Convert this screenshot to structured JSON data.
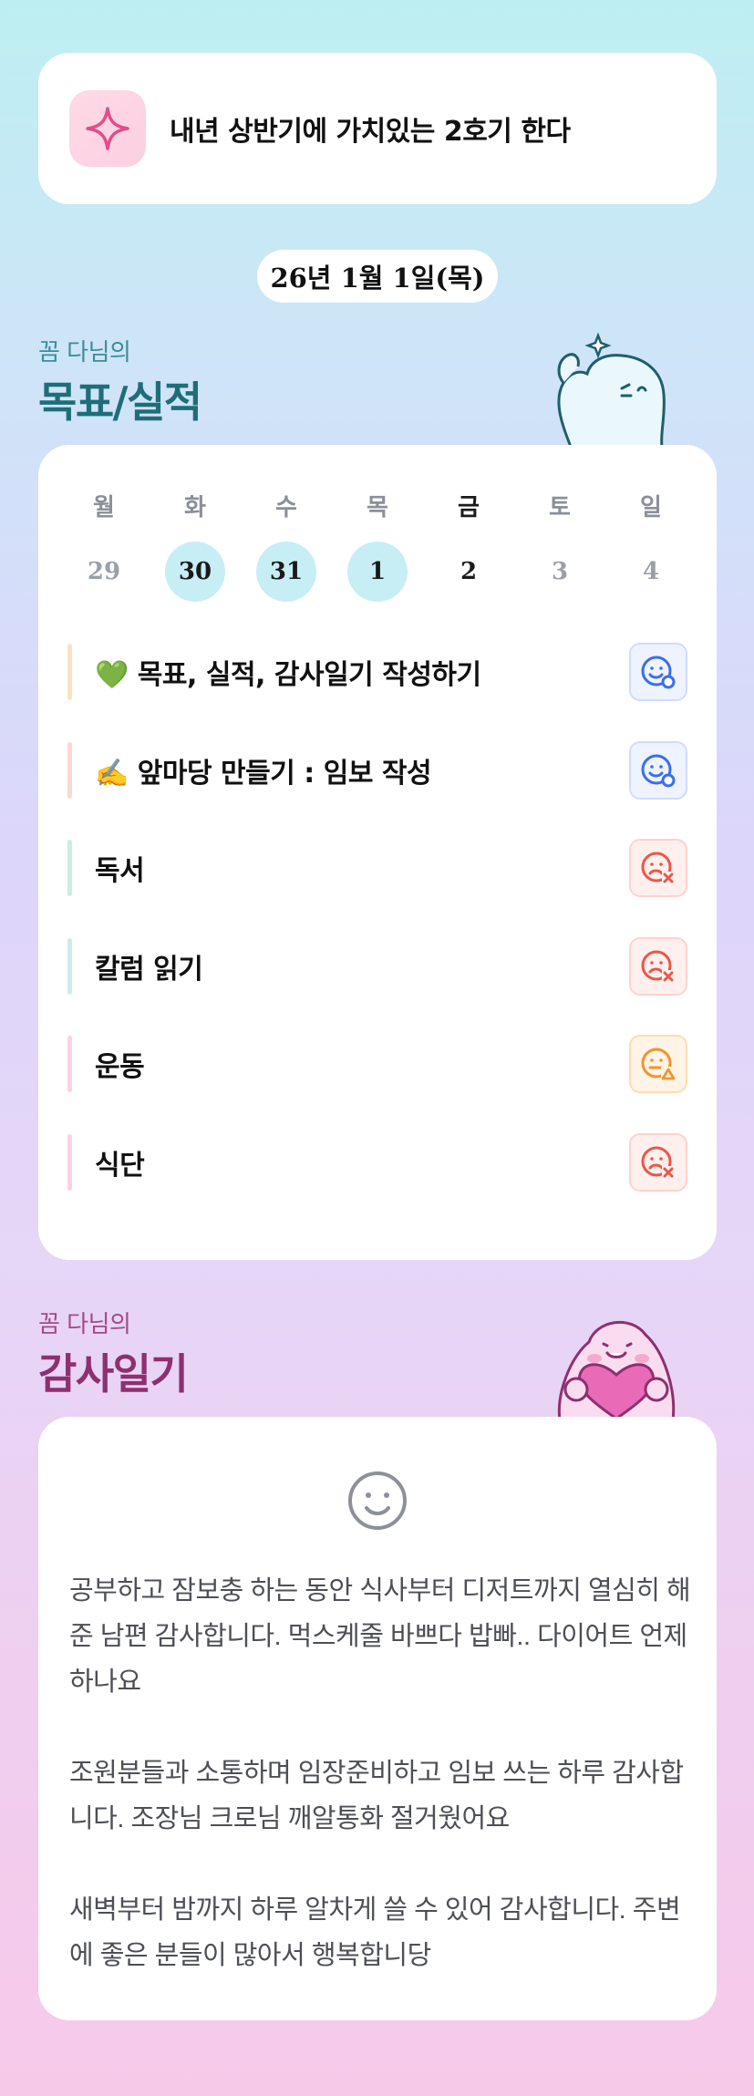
{
  "goal_banner": {
    "icon": "sparkle-icon",
    "text": "내년 상반기에 가치있는 2호기 한다"
  },
  "date": "26년 1월 1일(목)",
  "goals_section": {
    "owner": "꼼 다님의",
    "heading": "목표/실적"
  },
  "week": {
    "days_of_week": [
      "월",
      "화",
      "수",
      "목",
      "금",
      "토",
      "일"
    ],
    "dates": [
      "29",
      "30",
      "31",
      "1",
      "2",
      "3",
      "4"
    ],
    "marked": [
      false,
      true,
      true,
      true,
      false,
      false,
      false
    ],
    "today_index": 4
  },
  "tasks": [
    {
      "label": "💚 목표, 실적, 감사일기 작성하기",
      "status": "done",
      "bar_color": "#fbe3c2"
    },
    {
      "label": "✍️ 앞마당 만들기 : 임보 작성",
      "status": "done",
      "bar_color": "#fbd6d2"
    },
    {
      "label": "독서",
      "status": "fail",
      "bar_color": "#c9eee4"
    },
    {
      "label": "칼럼 읽기",
      "status": "fail",
      "bar_color": "#c9ecf2"
    },
    {
      "label": "운동",
      "status": "partial",
      "bar_color": "#f9d2e6"
    },
    {
      "label": "식단",
      "status": "fail",
      "bar_color": "#f9d2e6"
    }
  ],
  "status_colors": {
    "done": "#3b6ee8",
    "fail": "#e8584a",
    "partial": "#f0952e"
  },
  "gratitude_section": {
    "owner": "꼼 다님의",
    "heading": "감사일기"
  },
  "gratitude": {
    "icon": "smile-icon",
    "entries": [
      "공부하고 잠보충 하는 동안 식사부터 디저트까지 열심히 해준 남편 감사합니다. 먹스케줄 바쁘다 밥빠.. 다이어트 언제 하나요",
      "조원분들과 소통하며 임장준비하고 임보 쓰는 하루 감사합니다. 조장님 크로님 깨알통화 절거웠어요",
      "새벽부터 밤까지 하루 알차게 쓸 수 있어 감사합니다. 주변에 좋은 분들이 많아서 행복합니당"
    ]
  }
}
